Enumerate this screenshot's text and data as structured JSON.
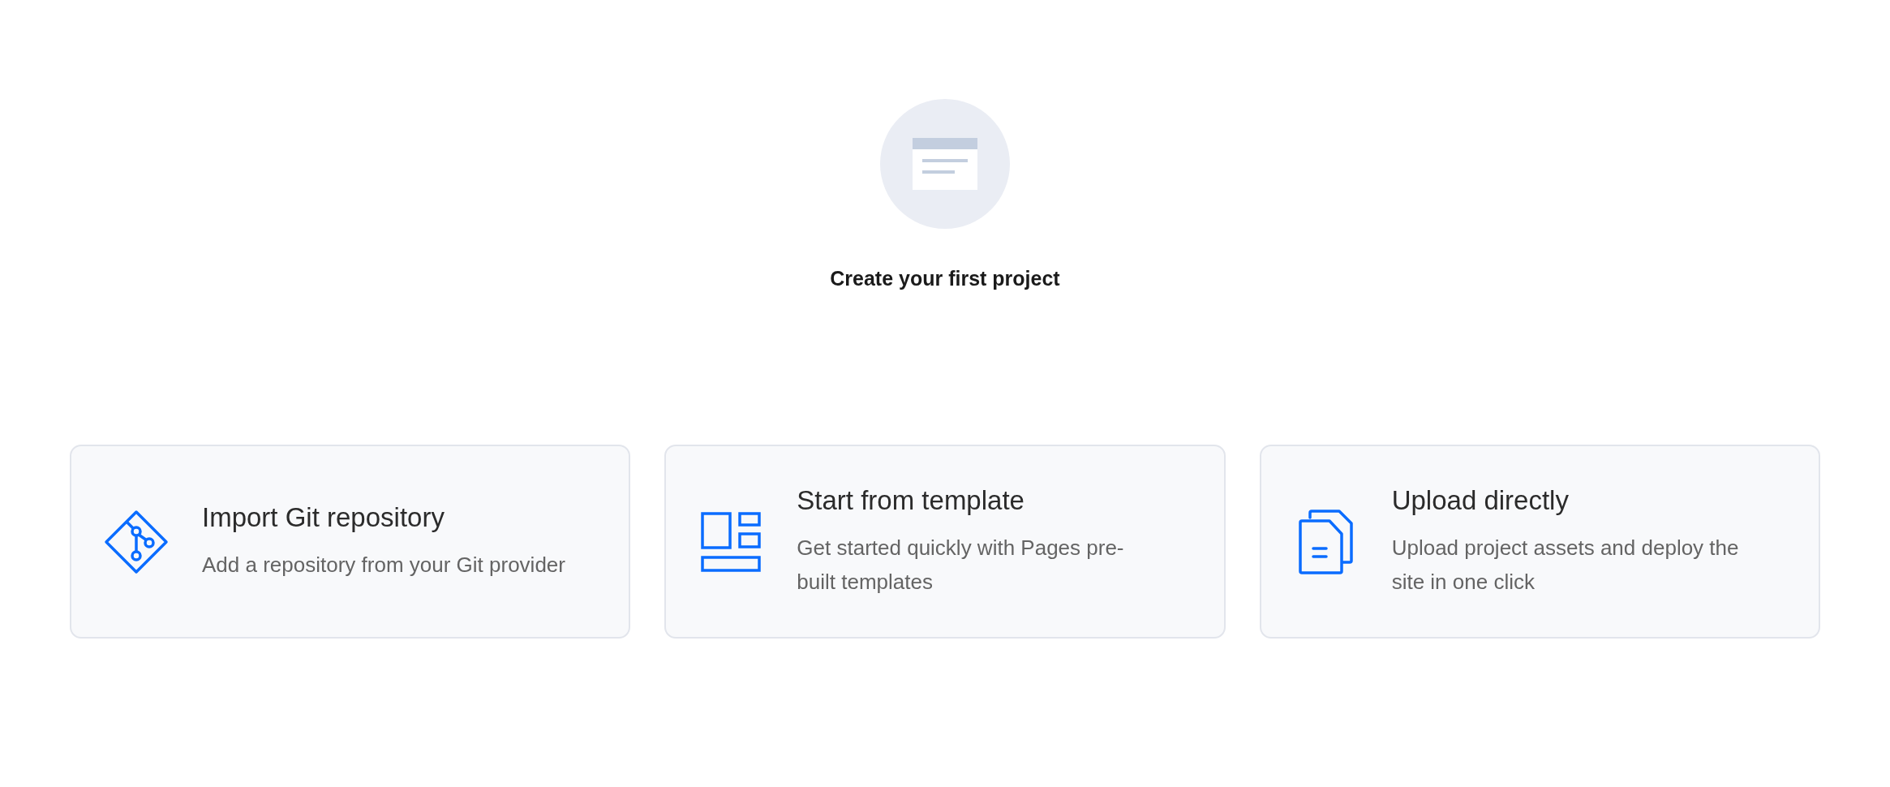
{
  "empty_state": {
    "title": "Create your first project"
  },
  "options": [
    {
      "kind": "git",
      "title": "Import Git repository",
      "description": "Add a repository from your Git provider"
    },
    {
      "kind": "template",
      "title": "Start from template",
      "description": "Get started quickly with Pages pre-built templates"
    },
    {
      "kind": "upload",
      "title": "Upload directly",
      "description": "Upload project assets and deploy the site in one click"
    }
  ]
}
